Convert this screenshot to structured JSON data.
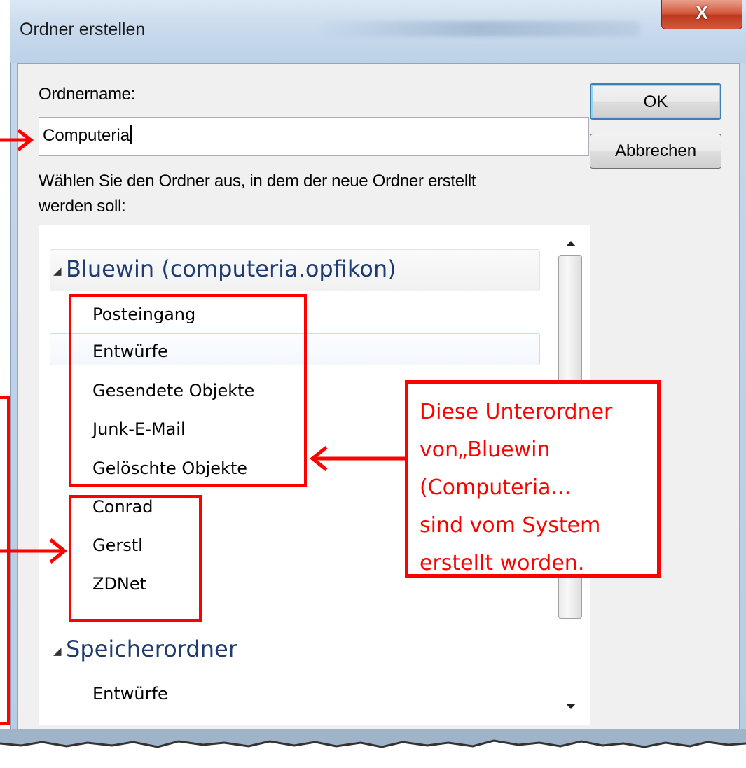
{
  "window": {
    "title": "Ordner erstellen",
    "close_label": "X"
  },
  "form": {
    "name_label": "Ordnername:",
    "name_value": "Computeria",
    "select_label_line1": "Wählen Sie den Ordner aus, in dem der neue Ordner erstellt",
    "select_label_line2": "werden soll:"
  },
  "buttons": {
    "ok": "OK",
    "cancel": "Abbrechen"
  },
  "tree": {
    "accounts": [
      {
        "name": "Bluewin (computeria.opfikon)",
        "folders": [
          "Posteingang",
          "Entwürfe",
          "Gesendete Objekte",
          "Junk-E-Mail",
          "Gelöschte Objekte",
          "Conrad",
          "Gerstl",
          "ZDNet"
        ]
      },
      {
        "name": "Speicherordner",
        "folders": [
          "Entwürfe"
        ]
      }
    ]
  },
  "annotation": {
    "line1": "Diese Unterordner",
    "line2": "von„Bluewin",
    "line3": "(Computeria...",
    "line4": "sind vom System",
    "line5": "erstellt worden."
  },
  "colors": {
    "annotation": "#ff0000",
    "account_text": "#1e3c72",
    "close_button": "#c0391f"
  }
}
